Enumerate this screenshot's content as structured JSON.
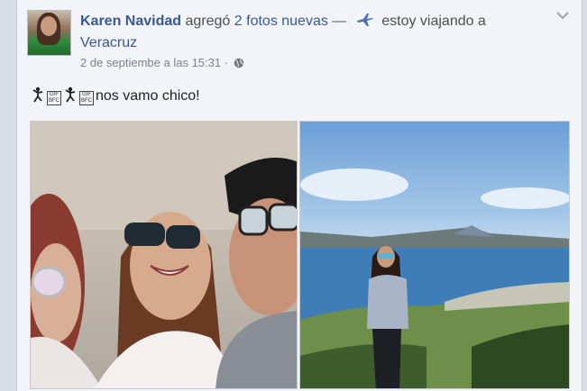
{
  "post": {
    "author": "Karen Navidad",
    "action_text": "agregó",
    "photos_link": "2 fotos nuevas",
    "separator": "—",
    "activity_icon": "airplane-icon",
    "activity": "estoy viajando a",
    "place": "Veracruz",
    "timestamp": "2 de septiembe a las 15:31",
    "timestamp_dot": "·",
    "privacy_icon": "globe-icon",
    "menu_icon": "chevron-down-icon",
    "message_text": "nos vamo chico!",
    "message_glyphs": [
      "dancer-icon",
      "gif-box",
      "dancer-icon",
      "gif-box"
    ],
    "gif_box_label": "GIF\nBFC"
  },
  "photos": [
    {
      "subject": "group selfie"
    },
    {
      "subject": "woman at lakeside"
    }
  ],
  "colors": {
    "link": "#365899",
    "text": "#1d2129",
    "meta": "#7d828c",
    "card": "#f3f4f7"
  }
}
